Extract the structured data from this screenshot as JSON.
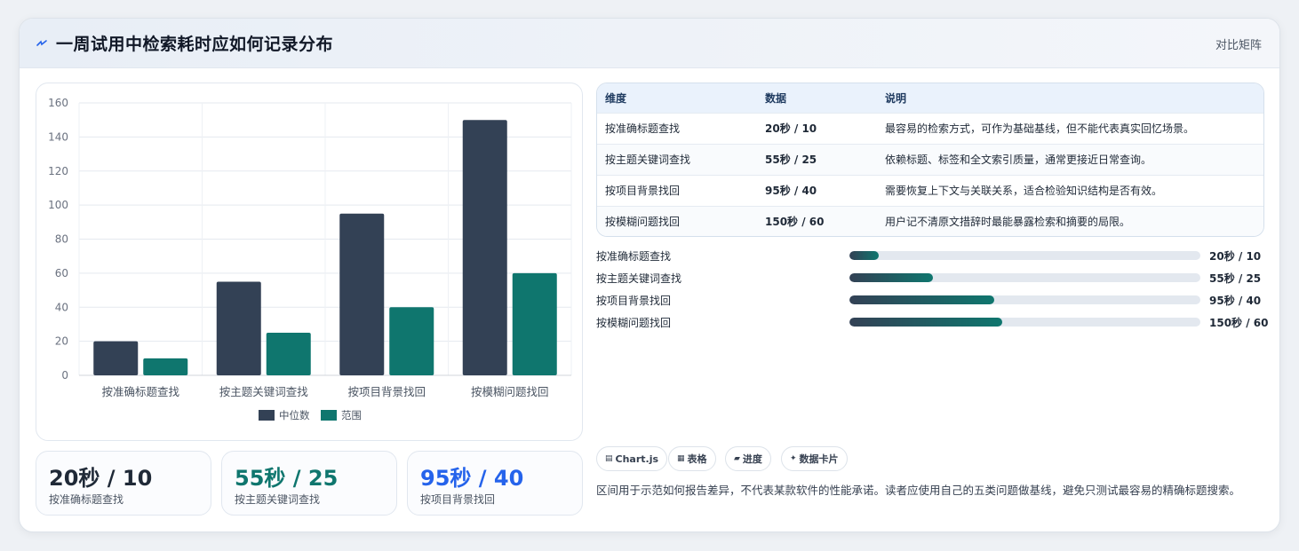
{
  "header": {
    "title": "一周试用中检索耗时应如何记录分布",
    "link_label": "对比矩阵"
  },
  "chart_data": {
    "type": "bar",
    "categories": [
      "按准确标题查找",
      "按主题关键词查找",
      "按项目背景找回",
      "按模糊问题找回"
    ],
    "series": [
      {
        "name": "中位数",
        "values": [
          20,
          55,
          95,
          150
        ],
        "color": "#334155"
      },
      {
        "name": "范围",
        "values": [
          10,
          25,
          40,
          60
        ],
        "color": "#0f766e"
      }
    ],
    "ylim": [
      0,
      160
    ],
    "yticks": [
      "0",
      "20",
      "40",
      "60",
      "80",
      "100",
      "120",
      "140",
      "160"
    ],
    "legend": "bottom",
    "grid": true
  },
  "stats": [
    {
      "value": "20秒 / 10",
      "label": "按准确标题查找",
      "color": "#1f2937"
    },
    {
      "value": "55秒 / 25",
      "label": "按主题关键词查找",
      "color": "#0f766e"
    },
    {
      "value": "95秒 / 40",
      "label": "按项目背景找回",
      "color": "#2563eb"
    }
  ],
  "table": {
    "headers": [
      "维度",
      "数据",
      "说明"
    ],
    "rows": [
      [
        "按准确标题查找",
        "20秒 / 10",
        "最容易的检索方式，可作为基础基线，但不能代表真实回忆场景。"
      ],
      [
        "按主题关键词查找",
        "55秒 / 25",
        "依赖标题、标签和全文索引质量，通常更接近日常查询。"
      ],
      [
        "按项目背景找回",
        "95秒 / 40",
        "需要恢复上下文与关联关系，适合检验知识结构是否有效。"
      ],
      [
        "按模糊问题找回",
        "150秒 / 60",
        "用户记不清原文措辞时最能暴露检索和摘要的局限。"
      ]
    ]
  },
  "progress": [
    {
      "label": "按准确标题查找",
      "value_text": "20秒 / 10",
      "fraction": 0.084
    },
    {
      "label": "按主题关键词查找",
      "value_text": "55秒 / 25",
      "fraction": 0.237
    },
    {
      "label": "按项目背景找回",
      "value_text": "95秒 / 40",
      "fraction": 0.413
    },
    {
      "label": "按模糊问题找回",
      "value_text": "150秒 / 60",
      "fraction": 0.435
    }
  ],
  "chips": [
    {
      "icon": "▤",
      "label": "Chart.js"
    },
    {
      "icon": "▦",
      "label": "表格"
    },
    {
      "icon": "▰",
      "label": "进度"
    },
    {
      "icon": "✦",
      "label": "数据卡片"
    }
  ],
  "note": "区间用于示范如何报告差异，不代表某款软件的性能承诺。读者应使用自己的五类问题做基线，避免只测试最容易的精确标题搜索。"
}
